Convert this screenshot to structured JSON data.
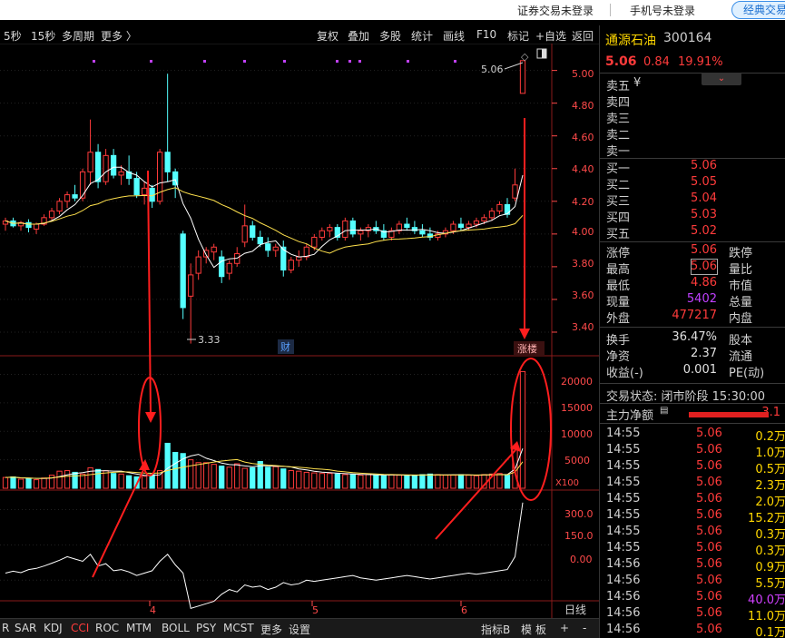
{
  "topbar": {
    "securities_login": "证券交易未登录",
    "phone_login": "手机号未登录",
    "classic": "经典交易"
  },
  "toolbar": {
    "left": [
      "5秒",
      "15秒",
      "多周期",
      "更多 〉"
    ],
    "right": [
      "复权",
      "叠加",
      "多股",
      "统计",
      "画线",
      "F10",
      "标记",
      "+自选",
      "返回"
    ]
  },
  "chart": {
    "price_axis": [
      "5.00",
      "4.80",
      "4.60",
      "4.40",
      "4.20",
      "4.00",
      "3.80",
      "3.60",
      "3.40"
    ],
    "high_label": "5.06",
    "low_label": "3.33",
    "cai_badge": "财",
    "limit_up_badge": "涨楼",
    "vol_axis": [
      "20000",
      "15000",
      "10000",
      "5000"
    ],
    "vol_unit": "X100",
    "cci_axis": [
      "300.0",
      "150.0",
      "0.00"
    ],
    "date_labels": [
      "4",
      "5",
      "6"
    ],
    "period_label": "日线",
    "colors": {
      "up": "#ff3b3b",
      "down": "#54ffff",
      "ma5": "#ffffff",
      "ma10": "#ffe14d",
      "annotation": "#ff1e1e"
    }
  },
  "bottombar": {
    "tabs": [
      "R",
      "SAR",
      "KDJ",
      "CCI",
      "ROC",
      "MTM",
      "BOLL",
      "PSY",
      "MCST",
      "更多",
      "设置"
    ],
    "active": "CCI",
    "right": [
      "指标B",
      "模",
      "板",
      "+",
      "-"
    ]
  },
  "quote": {
    "name": "通源石油",
    "code": "300164",
    "price": "5.06",
    "change": "0.84",
    "pct": "19.91%",
    "sell": [
      {
        "label": "卖五",
        "price": "¥",
        "vol": ""
      },
      {
        "label": "卖四",
        "price": "",
        "vol": ""
      },
      {
        "label": "卖三",
        "price": "",
        "vol": ""
      },
      {
        "label": "卖二",
        "price": "",
        "vol": ""
      },
      {
        "label": "卖一",
        "price": "",
        "vol": ""
      }
    ],
    "buy": [
      {
        "label": "买一",
        "price": "5.06"
      },
      {
        "label": "买二",
        "price": "5.05"
      },
      {
        "label": "买三",
        "price": "5.04"
      },
      {
        "label": "买四",
        "price": "5.03"
      },
      {
        "label": "买五",
        "price": "5.02"
      }
    ],
    "stats": [
      {
        "l": "涨停",
        "v": "5.06",
        "l2": "跌停"
      },
      {
        "l": "最高",
        "v": "5.06",
        "l2": "量比"
      },
      {
        "l": "最低",
        "v": "4.86",
        "l2": "市值"
      },
      {
        "l": "现量",
        "v": "5402",
        "l2": "总量"
      },
      {
        "l": "外盘",
        "v": "477217",
        "l2": "内盘"
      }
    ],
    "stats2": [
      {
        "l": "换手",
        "v": "36.47%",
        "l2": "股本"
      },
      {
        "l": "净资",
        "v": "2.37",
        "l2": "流通"
      },
      {
        "l": "收益(-)",
        "v": "0.001",
        "l2": "PE(动)"
      }
    ],
    "trade_status": "交易状态: 闭市阶段 15:30:00",
    "main_net_label": "主力净额",
    "main_net_value": "3.1",
    "ticks": [
      {
        "t": "14:55",
        "p": "5.06",
        "v": "0.2万"
      },
      {
        "t": "14:55",
        "p": "5.06",
        "v": "1.0万"
      },
      {
        "t": "14:55",
        "p": "5.06",
        "v": "0.5万"
      },
      {
        "t": "14:55",
        "p": "5.06",
        "v": "2.3万"
      },
      {
        "t": "14:55",
        "p": "5.06",
        "v": "2.0万"
      },
      {
        "t": "14:55",
        "p": "5.06",
        "v": "15.2万"
      },
      {
        "t": "14:55",
        "p": "5.06",
        "v": "0.3万"
      },
      {
        "t": "14:55",
        "p": "5.06",
        "v": "0.3万"
      },
      {
        "t": "14:56",
        "p": "5.06",
        "v": "0.9万"
      },
      {
        "t": "14:56",
        "p": "5.06",
        "v": "5.5万"
      },
      {
        "t": "14:56",
        "p": "5.06",
        "v": "40.0万"
      },
      {
        "t": "14:56",
        "p": "5.06",
        "v": "11.0万"
      },
      {
        "t": "14:56",
        "p": "5.06",
        "v": "0.1万"
      }
    ]
  },
  "chart_data": {
    "type": "candlestick",
    "ohlc": [
      [
        4.06,
        4.1,
        4.02,
        4.08
      ],
      [
        4.08,
        4.1,
        4.04,
        4.05
      ],
      [
        4.05,
        4.08,
        4.02,
        4.07
      ],
      [
        4.07,
        4.09,
        4.01,
        4.04
      ],
      [
        4.03,
        4.07,
        4.0,
        4.06
      ],
      [
        4.06,
        4.12,
        4.05,
        4.1
      ],
      [
        4.1,
        4.16,
        4.08,
        4.14
      ],
      [
        4.14,
        4.22,
        4.12,
        4.2
      ],
      [
        4.2,
        4.26,
        4.16,
        4.24
      ],
      [
        4.24,
        4.3,
        4.2,
        4.22
      ],
      [
        4.22,
        4.4,
        4.2,
        4.38
      ],
      [
        4.38,
        4.7,
        4.3,
        4.5
      ],
      [
        4.5,
        4.55,
        4.28,
        4.32
      ],
      [
        4.32,
        4.52,
        4.3,
        4.48
      ],
      [
        4.48,
        4.52,
        4.34,
        4.36
      ],
      [
        4.36,
        4.42,
        4.3,
        4.38
      ],
      [
        4.38,
        4.48,
        4.3,
        4.34
      ],
      [
        4.34,
        4.38,
        4.22,
        4.24
      ],
      [
        4.24,
        4.32,
        4.18,
        4.28
      ],
      [
        4.28,
        4.3,
        4.16,
        4.2
      ],
      [
        4.2,
        4.52,
        4.18,
        4.5
      ],
      [
        4.5,
        4.98,
        4.32,
        4.38
      ],
      [
        4.38,
        4.4,
        4.22,
        4.3
      ],
      [
        4.0,
        4.02,
        3.48,
        3.55
      ],
      [
        3.62,
        3.82,
        3.33,
        3.75
      ],
      [
        3.76,
        3.9,
        3.72,
        3.86
      ],
      [
        3.86,
        3.92,
        3.82,
        3.9
      ],
      [
        3.89,
        3.94,
        3.84,
        3.92
      ],
      [
        3.86,
        3.9,
        3.7,
        3.74
      ],
      [
        3.76,
        3.84,
        3.72,
        3.82
      ],
      [
        3.82,
        3.92,
        3.8,
        3.88
      ],
      [
        3.95,
        4.18,
        3.92,
        4.05
      ],
      [
        4.05,
        4.08,
        3.96,
        3.98
      ],
      [
        3.98,
        4.02,
        3.92,
        3.94
      ],
      [
        3.94,
        3.98,
        3.86,
        3.9
      ],
      [
        3.9,
        3.94,
        3.86,
        3.92
      ],
      [
        3.92,
        3.96,
        3.74,
        3.78
      ],
      [
        3.78,
        3.86,
        3.76,
        3.84
      ],
      [
        3.84,
        3.9,
        3.8,
        3.86
      ],
      [
        3.86,
        3.94,
        3.84,
        3.92
      ],
      [
        3.92,
        4.0,
        3.9,
        3.98
      ],
      [
        3.98,
        4.04,
        3.96,
        4.02
      ],
      [
        4.02,
        4.06,
        3.98,
        4.04
      ],
      [
        4.04,
        4.06,
        3.96,
        3.98
      ],
      [
        3.98,
        4.1,
        3.96,
        4.08
      ],
      [
        4.08,
        4.1,
        3.98,
        4.0
      ],
      [
        4.0,
        4.04,
        3.96,
        4.02
      ],
      [
        4.02,
        4.06,
        3.98,
        4.04
      ],
      [
        4.04,
        4.08,
        4.0,
        4.02
      ],
      [
        4.02,
        4.06,
        3.96,
        3.98
      ],
      [
        3.98,
        4.04,
        3.96,
        4.02
      ],
      [
        4.02,
        4.08,
        4.0,
        4.06
      ],
      [
        4.06,
        4.1,
        4.02,
        4.04
      ],
      [
        4.04,
        4.08,
        4.0,
        4.02
      ],
      [
        4.02,
        4.06,
        3.98,
        4.0
      ],
      [
        4.0,
        4.04,
        3.96,
        3.98
      ],
      [
        3.98,
        4.02,
        3.96,
        4.0
      ],
      [
        4.0,
        4.04,
        3.98,
        4.02
      ],
      [
        4.02,
        4.08,
        4.0,
        4.06
      ],
      [
        4.06,
        4.1,
        4.02,
        4.04
      ],
      [
        4.04,
        4.08,
        4.02,
        4.06
      ],
      [
        4.06,
        4.1,
        4.04,
        4.08
      ],
      [
        4.08,
        4.12,
        4.06,
        4.1
      ],
      [
        4.1,
        4.16,
        4.08,
        4.14
      ],
      [
        4.14,
        4.2,
        4.12,
        4.18
      ],
      [
        4.18,
        4.22,
        4.1,
        4.12
      ],
      [
        4.22,
        4.4,
        4.2,
        4.3
      ],
      [
        4.86,
        5.06,
        4.86,
        5.06
      ]
    ],
    "volume": [
      1900,
      2000,
      1600,
      1700,
      1500,
      1800,
      2300,
      3000,
      3100,
      2800,
      2500,
      3600,
      3300,
      3100,
      2600,
      2500,
      2200,
      2000,
      2100,
      2400,
      3100,
      7900,
      6300,
      6100,
      5000,
      4500,
      4500,
      4200,
      3900,
      3700,
      4300,
      3500,
      3600,
      4700,
      3700,
      3800,
      3400,
      3100,
      3000,
      2800,
      2700,
      2600,
      2600,
      2500,
      2400,
      2400,
      2300,
      2400,
      2300,
      2200,
      2400,
      2300,
      2300,
      2200,
      2400,
      2500,
      2400,
      2300,
      2300,
      2400,
      2300,
      2200,
      2400,
      2500,
      2600,
      2300,
      7000,
      20500
    ],
    "cci": [
      30,
      38,
      32,
      45,
      50,
      60,
      72,
      85,
      100,
      90,
      80,
      110,
      60,
      70,
      40,
      45,
      35,
      20,
      30,
      40,
      80,
      110,
      65,
      30,
      -120,
      -110,
      -100,
      -90,
      -60,
      -40,
      -50,
      -20,
      -30,
      -25,
      -40,
      -30,
      -10,
      -20,
      -15,
      0,
      -5,
      0,
      5,
      10,
      15,
      20,
      10,
      5,
      0,
      5,
      10,
      15,
      20,
      15,
      10,
      5,
      10,
      15,
      20,
      25,
      30,
      25,
      30,
      35,
      40,
      45,
      100,
      330
    ],
    "price_ylim": [
      3.3,
      5.12
    ],
    "vol_ylim": [
      0,
      22000
    ],
    "cci_ylim": [
      -80,
      360
    ]
  }
}
